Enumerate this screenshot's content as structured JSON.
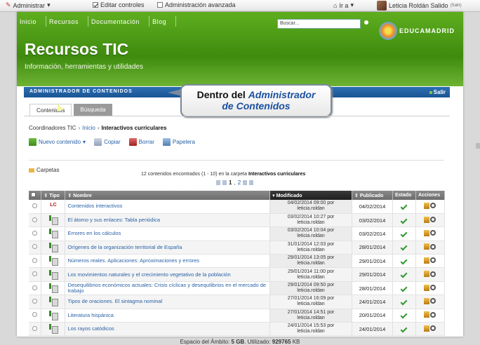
{
  "topbar": {
    "admin_label": "Administrar",
    "edit_controls_label": "Editar controles",
    "advanced_admin_label": "Administración avanzada",
    "goto_label": "Ir a",
    "user_name": "Leticia Roldán Salido",
    "user_logout": "(Salir)"
  },
  "nav": {
    "tabs": [
      "Inicio",
      "Recursos",
      "Documentación",
      "Blog"
    ],
    "search_placeholder": "Buscar..."
  },
  "logo_text": "EDUCAMADRID",
  "site": {
    "title": "Recursos TIC",
    "subtitle": "Información, herramientas y utilidades"
  },
  "portlet": {
    "title": "ADMINISTRADOR DE CONTENIDOS",
    "exit_label": "Salir"
  },
  "callout": {
    "prefix": "Dentro del ",
    "emph_line1": "Administrador",
    "emph_line2": "de Contenidos"
  },
  "tabs": [
    "Contenidos",
    "Búsqueda"
  ],
  "breadcrumb": {
    "root": "Coordinadores TIC",
    "link": "Inicio",
    "current": "Interactivos curriculares"
  },
  "toolbar": {
    "new_label": "Nuevo contenido",
    "copy_label": "Copiar",
    "delete_label": "Borrar",
    "bin_label": "Papelera"
  },
  "folders_label": "Carpetas",
  "count": {
    "text": "12 contenidos encontrados (1 - 10) en la carpeta ",
    "folder": "Interactivos curriculares"
  },
  "pager": {
    "current": "1",
    "next": "2"
  },
  "table": {
    "headers": [
      "Tipo",
      "Nombre",
      "Modificado",
      "Publicado",
      "Estado",
      "Acciones"
    ],
    "rows": [
      {
        "type": "lc",
        "name": "Contenidos interactivos",
        "mod_date": "04/02/2014 09:00 por",
        "mod_user": "leticia.roldan",
        "published": "04/02/2014"
      },
      {
        "type": "doc",
        "name": "El átomo y sus enlaces: Tabla periódica",
        "mod_date": "03/02/2014 10:27 por",
        "mod_user": "leticia.roldan",
        "published": "03/02/2014"
      },
      {
        "type": "doc",
        "name": "Errores en los cálculos",
        "mod_date": "03/02/2014 10:04 por",
        "mod_user": "leticia.roldan",
        "published": "03/02/2014"
      },
      {
        "type": "doc",
        "name": "Orígenes de la organización territorial de España",
        "mod_date": "31/01/2014 12:03 por",
        "mod_user": "leticia.roldan",
        "published": "28/01/2014"
      },
      {
        "type": "doc",
        "name": "Números reales. Aplicaciones: Aproximaciones y errores",
        "mod_date": "29/01/2014 13:05 por",
        "mod_user": "leticia.roldan",
        "published": "29/01/2014"
      },
      {
        "type": "doc",
        "name": "Los movimientos naturales y el crecimiento vegetativo de la población",
        "mod_date": "29/01/2014 11:00 por",
        "mod_user": "leticia.roldan",
        "published": "29/01/2014"
      },
      {
        "type": "doc",
        "name": "Desequilibrios económicos actuales: Crisis cíclicas y desequilibrios en el mercado de trabajo",
        "mod_date": "29/01/2014 09:50 por",
        "mod_user": "leticia.roldan",
        "published": "28/01/2014"
      },
      {
        "type": "doc",
        "name": "Tipos de oraciones. El sintagma nominal",
        "mod_date": "27/01/2014 16:09 por",
        "mod_user": "leticia.roldan",
        "published": "24/01/2014"
      },
      {
        "type": "doc",
        "name": "Literatura hispánica",
        "mod_date": "27/01/2014 14:51 por",
        "mod_user": "leticia.roldan",
        "published": "20/01/2014"
      },
      {
        "type": "doc",
        "name": "Los rayos catódicos",
        "mod_date": "24/01/2014 15:53 por",
        "mod_user": "leticia.roldan",
        "published": "24/01/2014"
      }
    ]
  },
  "footer": {
    "prefix": "Espacio del Ámbito: ",
    "total": "5 GB",
    "used_prefix": ". Utilizado: ",
    "used": "929765",
    "suffix": " KB"
  }
}
